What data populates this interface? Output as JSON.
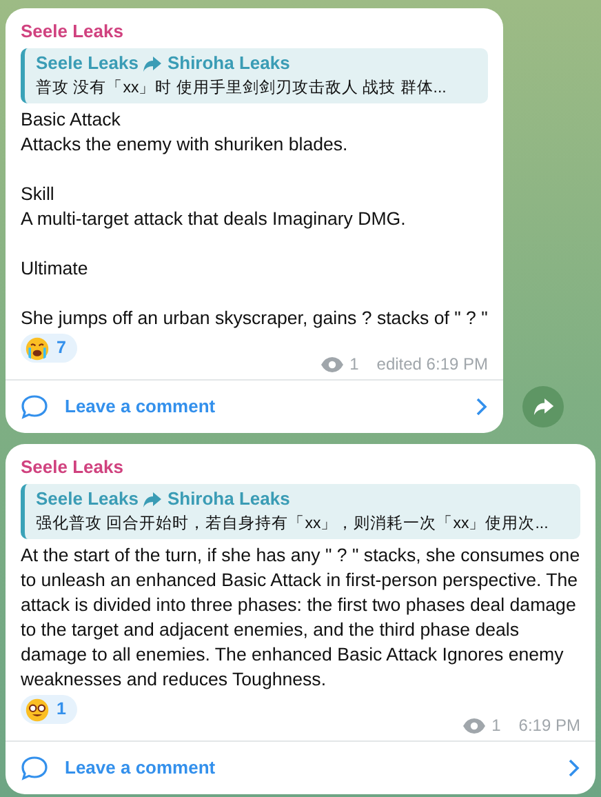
{
  "messages": [
    {
      "author": "Seele Leaks",
      "quote": {
        "from": "Seele Leaks",
        "to": "Shiroha Leaks",
        "text": "普攻  没有「xx」时 使用手里剑剑刃攻击敌人 战技  群体..."
      },
      "body": "Basic Attack\nAttacks the enemy with shuriken blades.\n\nSkill\nA multi-target attack that deals Imaginary DMG.\n\nUltimate\n\nShe jumps off an urban skyscraper, gains  ?  stacks of \" ? \"",
      "reaction": {
        "kind": "crying",
        "count": "7"
      },
      "views": "1",
      "time": "edited 6:19 PM",
      "comment": "Leave a comment",
      "share_button": true
    },
    {
      "author": "Seele Leaks",
      "quote": {
        "from": "Seele Leaks",
        "to": "Shiroha Leaks",
        "text": "强化普攻 回合开始时，若自身持有「xx」，则消耗一次「xx」使用次..."
      },
      "body": "At the start of the turn, if she has any \" ? \" stacks, she consumes one to unleash an enhanced Basic Attack in first-person perspective. The attack is divided into three phases: the first two phases deal damage to the target and adjacent enemies, and the third phase deals damage to all enemies. The enhanced Basic Attack Ignores enemy weaknesses  and reduces Toughness.",
      "reaction": {
        "kind": "nerd",
        "count": "1"
      },
      "views": "1",
      "time": "6:19 PM",
      "comment": "Leave a comment",
      "share_button": false
    }
  ]
}
